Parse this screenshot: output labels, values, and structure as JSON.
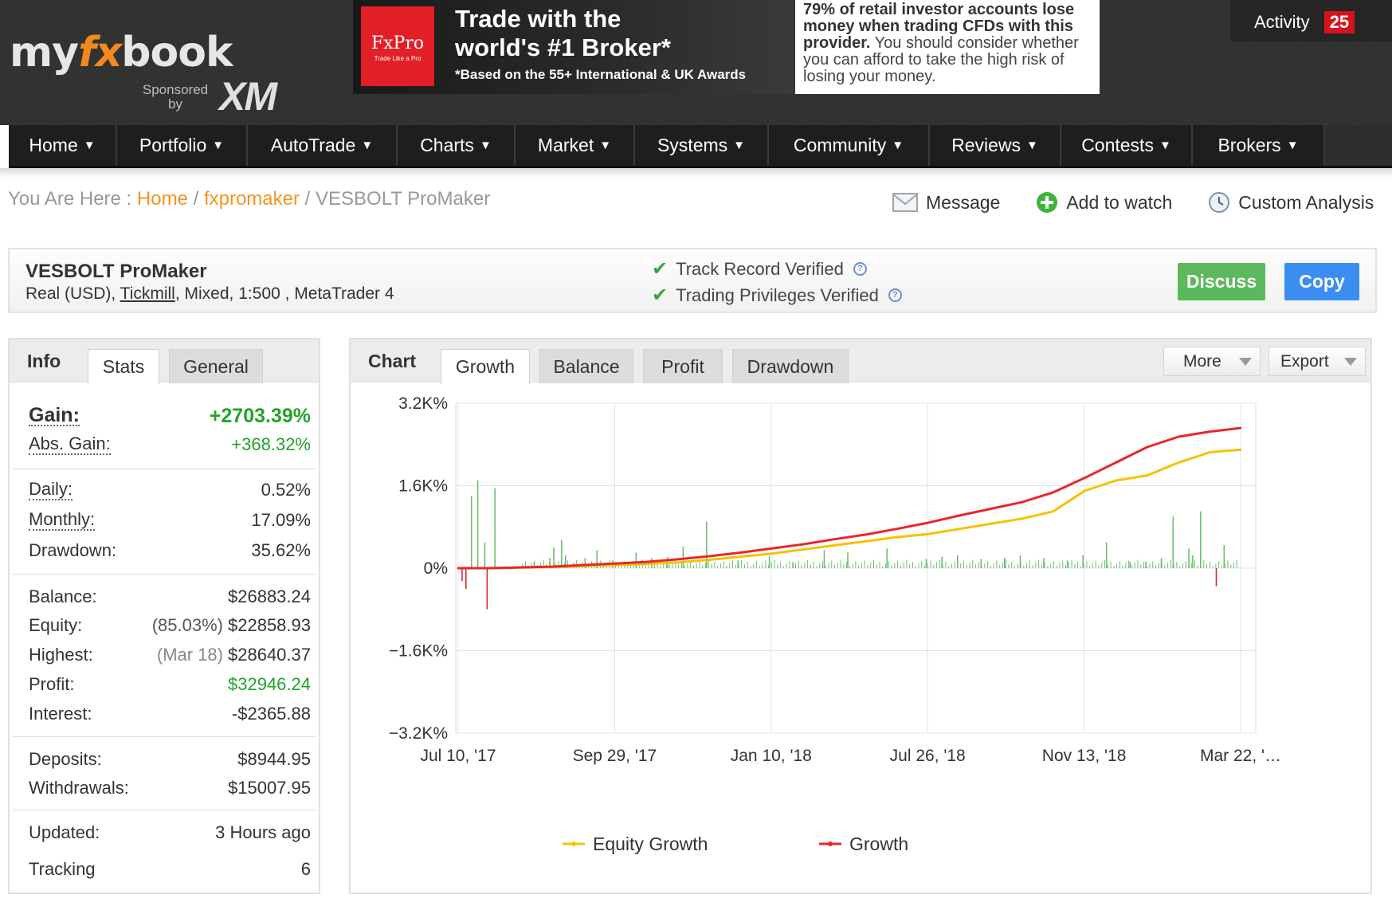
{
  "header": {
    "logo_pre": "my",
    "logo_fx": "fx",
    "logo_post": "book",
    "sponsored_line1": "Sponsored",
    "sponsored_line2": "by",
    "sponsor": "XM",
    "ad": {
      "brand": "FxPro",
      "brand_tag": "Trade Like a Pro",
      "headline": "Trade with the world's #1 Broker*",
      "subline": "*Based on the 55+ International & UK Awards"
    },
    "warning_bold": "79% of retail investor accounts lose money when trading CFDs with this provider.",
    "warning_rest": " You should consider whether you can afford to take the high risk of losing your money.",
    "activity_label": "Activity",
    "activity_count": "25"
  },
  "nav": [
    {
      "label": "Home"
    },
    {
      "label": "Portfolio"
    },
    {
      "label": "AutoTrade"
    },
    {
      "label": "Charts"
    },
    {
      "label": "Market"
    },
    {
      "label": "Systems"
    },
    {
      "label": "Community"
    },
    {
      "label": "Reviews"
    },
    {
      "label": "Contests"
    },
    {
      "label": "Brokers"
    }
  ],
  "breadcrumb": {
    "prefix": "You Are Here :",
    "home": "Home",
    "sep": "/",
    "owner": "fxpromaker",
    "current": "VESBOLT ProMaker"
  },
  "actions": {
    "message": "Message",
    "watch": "Add to watch",
    "analysis": "Custom Analysis"
  },
  "account": {
    "name": "VESBOLT ProMaker",
    "meta_pre": "Real (USD), ",
    "broker": "Tickmill",
    "meta_post": ", Mixed, 1:500 , MetaTrader 4",
    "verified_track": "Track Record Verified",
    "verified_privileges": "Trading Privileges Verified",
    "discuss": "Discuss",
    "copy": "Copy"
  },
  "info": {
    "tab_title": "Info",
    "tab_stats": "Stats",
    "tab_general": "General",
    "gain_label": "Gain:",
    "gain_value": "+2703.39%",
    "abs_gain_label": "Abs. Gain:",
    "abs_gain_value": "+368.32%",
    "daily_label": "Daily:",
    "daily_value": "0.52%",
    "monthly_label": "Monthly:",
    "monthly_value": "17.09%",
    "drawdown_label": "Drawdown:",
    "drawdown_value": "35.62%",
    "balance_label": "Balance:",
    "balance_value": "$26883.24",
    "equity_label": "Equity:",
    "equity_pct": "(85.03%)",
    "equity_value": "$22858.93",
    "highest_label": "Highest:",
    "highest_date": "(Mar 18)",
    "highest_value": "$28640.37",
    "profit_label": "Profit:",
    "profit_value": "$32946.24",
    "interest_label": "Interest:",
    "interest_value": "-$2365.88",
    "deposits_label": "Deposits:",
    "deposits_value": "$8944.95",
    "withdrawals_label": "Withdrawals:",
    "withdrawals_value": "$15007.95",
    "updated_label": "Updated:",
    "updated_value": "3 Hours ago",
    "tracking_label": "Tracking",
    "tracking_value": "6"
  },
  "chart_panel": {
    "tab_title": "Chart",
    "tabs": [
      "Growth",
      "Balance",
      "Profit",
      "Drawdown"
    ],
    "more": "More",
    "export": "Export"
  },
  "colors": {
    "orange": "#f7931e",
    "green": "#21a32a",
    "equity_line": "#f5c200",
    "growth_line": "#e8262e",
    "bar_pos": "#6cc06c",
    "bar_neg": "#d9262e"
  },
  "chart_data": {
    "type": "line",
    "ylim": [
      -3200,
      3200
    ],
    "yticks": [
      {
        "v": 3200,
        "label": "3.2K%"
      },
      {
        "v": 1600,
        "label": "1.6K%"
      },
      {
        "v": 0,
        "label": "0%"
      },
      {
        "v": -1600,
        "label": "−1.6K%"
      },
      {
        "v": -3200,
        "label": "−3.2K%"
      }
    ],
    "xticks": [
      "Jul 10, '17",
      "Sep 29, '17",
      "Jan 10, '18",
      "Jul 26, '18",
      "Nov 13, '18",
      "Mar 22, '…"
    ],
    "series": [
      {
        "name": "Equity Growth",
        "color": "#f5c200",
        "values": [
          0,
          0,
          10,
          20,
          40,
          60,
          80,
          110,
          160,
          220,
          280,
          360,
          440,
          520,
          600,
          660,
          760,
          860,
          960,
          1100,
          1500,
          1700,
          1800,
          2050,
          2250,
          2300
        ]
      },
      {
        "name": "Growth",
        "color": "#e8262e",
        "values": [
          0,
          0,
          15,
          30,
          60,
          90,
          120,
          170,
          230,
          300,
          380,
          460,
          560,
          650,
          760,
          880,
          1020,
          1150,
          1280,
          1470,
          1750,
          2050,
          2350,
          2550,
          2650,
          2720
        ]
      }
    ],
    "bars": [
      {
        "x": 0.02,
        "v": 1400
      },
      {
        "x": 0.028,
        "v": 1700
      },
      {
        "x": 0.037,
        "v": 500
      },
      {
        "x": 0.05,
        "v": 1550
      },
      {
        "x": 0.04,
        "v": -800
      },
      {
        "x": 0.008,
        "v": -250
      },
      {
        "x": 0.013,
        "v": -400
      },
      {
        "x": 0.1,
        "v": 120
      },
      {
        "x": 0.12,
        "v": 200
      },
      {
        "x": 0.125,
        "v": 400
      },
      {
        "x": 0.135,
        "v": 550
      },
      {
        "x": 0.14,
        "v": 250
      },
      {
        "x": 0.165,
        "v": 200
      },
      {
        "x": 0.18,
        "v": 350
      },
      {
        "x": 0.2,
        "v": 150
      },
      {
        "x": 0.23,
        "v": 300
      },
      {
        "x": 0.25,
        "v": 200
      },
      {
        "x": 0.27,
        "v": 220
      },
      {
        "x": 0.29,
        "v": 420
      },
      {
        "x": 0.32,
        "v": 900
      },
      {
        "x": 0.36,
        "v": 150
      },
      {
        "x": 0.4,
        "v": 230
      },
      {
        "x": 0.43,
        "v": 120
      },
      {
        "x": 0.47,
        "v": 350
      },
      {
        "x": 0.5,
        "v": 300
      },
      {
        "x": 0.55,
        "v": 380
      },
      {
        "x": 0.6,
        "v": 180
      },
      {
        "x": 0.64,
        "v": 250
      },
      {
        "x": 0.67,
        "v": 180
      },
      {
        "x": 0.72,
        "v": 250
      },
      {
        "x": 0.78,
        "v": 150
      },
      {
        "x": 0.83,
        "v": 500
      },
      {
        "x": 0.86,
        "v": 120
      },
      {
        "x": 0.9,
        "v": 200
      },
      {
        "x": 0.935,
        "v": 380
      },
      {
        "x": 0.7,
        "v": 200
      },
      {
        "x": 0.8,
        "v": 250
      },
      {
        "x": 0.88,
        "v": 130
      },
      {
        "x": 0.94,
        "v": 250
      },
      {
        "x": 0.9,
        "v": 150
      },
      {
        "x": 0.915,
        "v": 1000
      },
      {
        "x": 0.95,
        "v": 1100
      },
      {
        "x": 0.98,
        "v": 450
      },
      {
        "x": 0.97,
        "v": -350
      },
      {
        "x": 0.62,
        "v": 220
      },
      {
        "x": 0.75,
        "v": 200
      }
    ]
  }
}
